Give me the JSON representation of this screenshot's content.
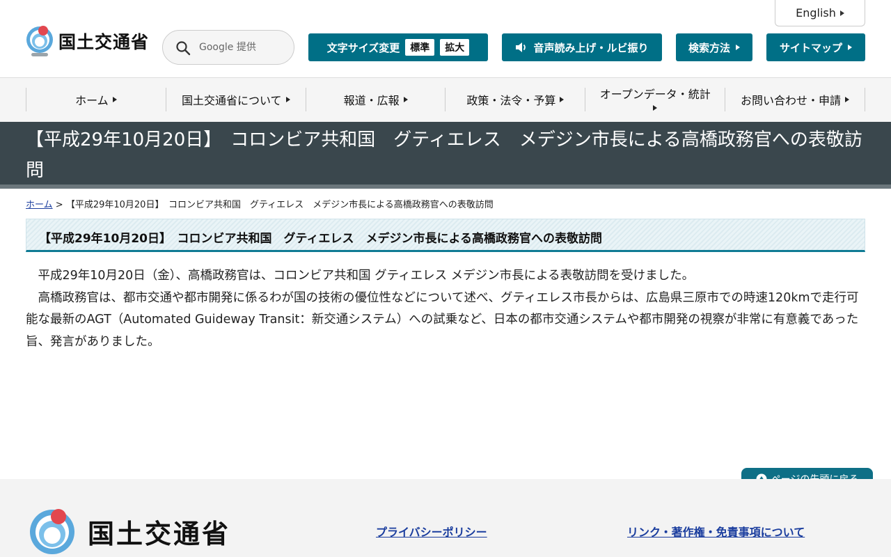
{
  "header": {
    "english_label": "English",
    "logo_text": "国土交通省",
    "search": {
      "placeholder": "Google 提供"
    },
    "font_size": {
      "label": "文字サイズ変更",
      "standard": "標準",
      "large": "拡大"
    },
    "speech_label": "音声読み上げ・ルビ振り",
    "search_howto_label": "検索方法",
    "sitemap_label": "サイトマップ"
  },
  "nav": {
    "items": [
      {
        "label": "ホーム"
      },
      {
        "label": "国土交通省について"
      },
      {
        "label": "報道・広報"
      },
      {
        "label": "政策・法令・予算"
      },
      {
        "label": "オープンデータ・統計"
      },
      {
        "label": "お問い合わせ・申請"
      }
    ]
  },
  "page": {
    "title": "【平成29年10月20日】　コロンビア共和国　グティエレス　メデジン市長による高橋政務官への表敬訪問",
    "breadcrumb": {
      "home": "ホーム",
      "separator": ">",
      "current": "【平成29年10月20日】　コロンビア共和国　グティエレス　メデジン市長による高橋政務官への表敬訪問"
    },
    "heading": "【平成29年10月20日】　コロンビア共和国　グティエレス　メデジン市長による高橋政務官への表敬訪問",
    "paragraphs": [
      "平成29年10月20日（金）、高橋政務官は、コロンビア共和国 グティエレス メデジン市長による表敬訪問を受けました。",
      "高橋政務官は、都市交通や都市開発に係るわが国の技術の優位性などについて述べ、グティエレス市長からは、広島県三原市での時速120kmで走行可能な最新のAGT（Automated Guideway Transit：新交通システム）への試乗など、日本の都市交通システムや都市開発の視察が非常に有意義であった旨、発言がありました。"
    ]
  },
  "footer": {
    "logo_text": "国土交通省",
    "privacy_label": "プライバシーポリシー",
    "links_label": "リンク・著作権・免責事項について",
    "pagetop_label": "ページの先頭に戻る"
  },
  "colors": {
    "teal": "#006f86",
    "title_band": "#3a474d",
    "link": "#1a3d9e"
  }
}
